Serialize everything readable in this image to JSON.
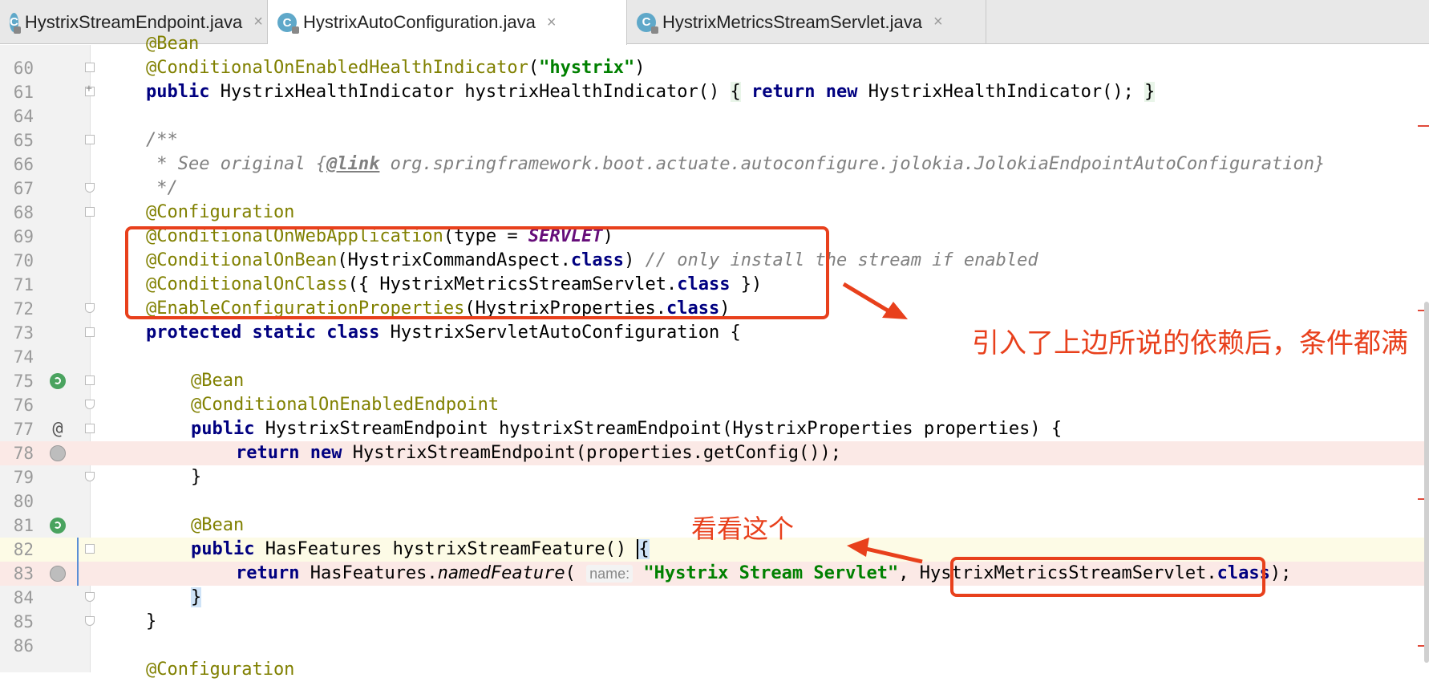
{
  "tabs": [
    {
      "label": "HystrixStreamEndpoint.java",
      "icon": "class-icon",
      "active": false
    },
    {
      "label": "HystrixAutoConfiguration.java",
      "icon": "class-icon",
      "active": true
    },
    {
      "label": "HystrixMetricsStreamServlet.java",
      "icon": "class-icon",
      "active": false
    }
  ],
  "tab_icon_letter": "C",
  "tab_close_glyph": "×",
  "lines": [
    {
      "num": "60",
      "html_key": "l60"
    },
    {
      "num": "61",
      "html_key": "l61"
    },
    {
      "num": "64",
      "html_key": "l64"
    },
    {
      "num": "65",
      "html_key": "l65"
    },
    {
      "num": "66",
      "html_key": "l66"
    },
    {
      "num": "67",
      "html_key": "l67"
    },
    {
      "num": "68",
      "html_key": "l68"
    },
    {
      "num": "69",
      "html_key": "l69"
    },
    {
      "num": "70",
      "html_key": "l70"
    },
    {
      "num": "71",
      "html_key": "l71"
    },
    {
      "num": "72",
      "html_key": "l72"
    },
    {
      "num": "73",
      "html_key": "l73"
    },
    {
      "num": "74",
      "html_key": "l74"
    },
    {
      "num": "75",
      "html_key": "l75"
    },
    {
      "num": "76",
      "html_key": "l76"
    },
    {
      "num": "77",
      "html_key": "l77"
    },
    {
      "num": "78",
      "html_key": "l78"
    },
    {
      "num": "79",
      "html_key": "l79"
    },
    {
      "num": "80",
      "html_key": "l80"
    },
    {
      "num": "81",
      "html_key": "l81"
    },
    {
      "num": "82",
      "html_key": "l82"
    },
    {
      "num": "83",
      "html_key": "l83"
    },
    {
      "num": "84",
      "html_key": "l84"
    },
    {
      "num": "85",
      "html_key": "l85"
    },
    {
      "num": "86",
      "html_key": "l86"
    }
  ],
  "code": {
    "l59_partial": "@Bean",
    "l60": {
      "ann": "@ConditionalOnEnabledHealthIndicator",
      "p1": "(",
      "str": "\"hystrix\"",
      "p2": ")"
    },
    "l61": {
      "kw1": "public",
      "t1": " HystrixHealthIndicator hystrixHealthIndicator() ",
      "b1": "{",
      "sp": " ",
      "kw2": "return",
      "sp2": " ",
      "kw3": "new",
      "t2": " HystrixHealthIndicator(); ",
      "b2": "}"
    },
    "l65": "/**",
    "l66": {
      "t1": " * See original {",
      "tag": "@link",
      "t2": " org.springframework.boot.actuate.autoconfigure.jolokia.JolokiaEndpointAutoConfiguration}"
    },
    "l67": " */",
    "l68": "@Configuration",
    "l69": {
      "ann": "@ConditionalOnWebApplication",
      "t1": "(type = ",
      "enm": "SERVLET",
      "t2": ")"
    },
    "l70": {
      "ann": "@ConditionalOnBean",
      "t1": "(HystrixCommandAspect.",
      "kw": "class",
      "t2": ") ",
      "cmt": "// only install the stream if enabled"
    },
    "l71": {
      "ann": "@ConditionalOnClass",
      "t1": "({ HystrixMetricsStreamServlet.",
      "kw": "class",
      "t2": " })"
    },
    "l72": {
      "ann": "@EnableConfigurationProperties",
      "t1": "(HystrixProperties.",
      "kw": "class",
      "t2": ")"
    },
    "l73": {
      "kw1": "protected",
      "kw2": "static",
      "kw3": "class",
      "t1": " HystrixServletAutoConfiguration {"
    },
    "l75": "@Bean",
    "l76": "@ConditionalOnEnabledEndpoint",
    "l77": {
      "kw": "public",
      "t1": " HystrixStreamEndpoint hystrixStreamEndpoint(HystrixProperties properties) {"
    },
    "l78": {
      "kw1": "return",
      "kw2": "new",
      "t1": " HystrixStreamEndpoint(properties.getConfig());"
    },
    "l79": "}",
    "l81": "@Bean",
    "l82": {
      "kw": "public",
      "t1": " HasFeatures hystrixStreamFeature() ",
      "brace": "{"
    },
    "l83": {
      "kw": "return",
      "t1": " HasFeatures.",
      "itl": "namedFeature",
      "t2": "( ",
      "hint": "name:",
      "str": "\"Hystrix Stream Servlet\"",
      "t3": ", HystrixMetricsStreamServlet.",
      "kw2": "class",
      "t4": ");"
    },
    "l84": "}",
    "l85": "}",
    "l87_partial": "@Configuration"
  },
  "annotations": {
    "note1": "引入了上边所说的依赖后，条件都满",
    "note2": "看看这个",
    "color": "#e8401c"
  }
}
